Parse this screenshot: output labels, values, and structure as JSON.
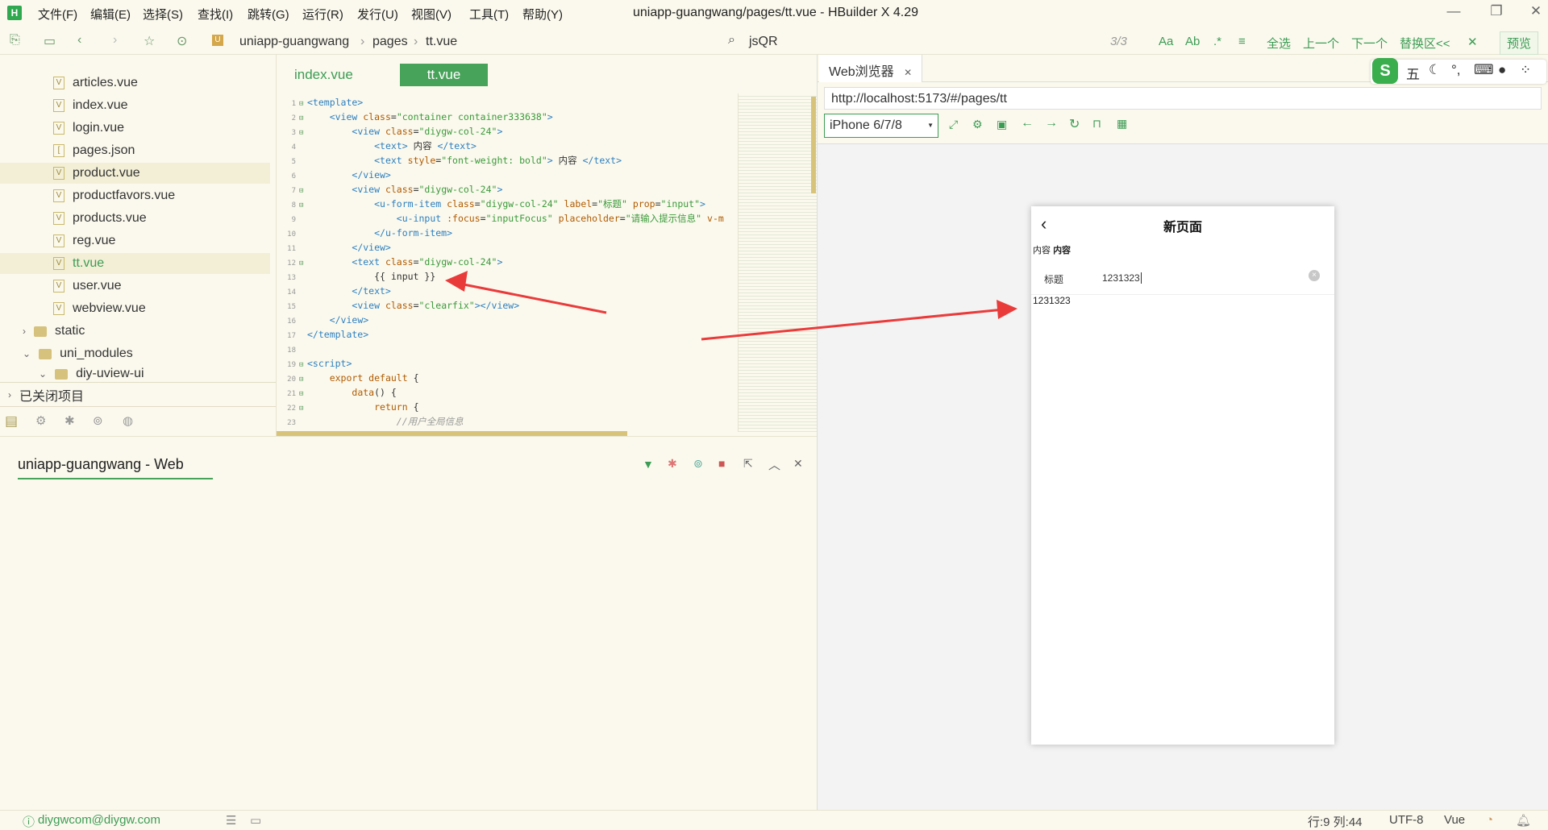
{
  "menu": [
    "文件(F)",
    "编辑(E)",
    "选择(S)",
    "查找(I)",
    "跳转(G)",
    "运行(R)",
    "发行(U)",
    "视图(V)",
    "工具(T)",
    "帮助(Y)"
  ],
  "window_title": "uniapp-guangwang/pages/tt.vue - HBuilder X 4.29",
  "breadcrumb": [
    "uniapp-guangwang",
    "pages",
    "tt.vue"
  ],
  "find": {
    "query": "jsQR",
    "count": "3/3",
    "select_all": "全选",
    "prev": "上一个",
    "next": "下一个",
    "replace": "替换区<<",
    "preview": "预览"
  },
  "files": [
    "articles.vue",
    "index.vue",
    "login.vue",
    "pages.json",
    "product.vue",
    "productfavors.vue",
    "products.vue",
    "reg.vue",
    "tt.vue",
    "user.vue",
    "webview.vue"
  ],
  "folders": {
    "static": "static",
    "uni_modules": "uni_modules",
    "diy": "diy-uview-ui",
    "closed": "已关闭项目"
  },
  "tabs": {
    "index": "index.vue",
    "tt": "tt.vue"
  },
  "code": [
    {
      "n": "1",
      "html": "<span class='tag'>&lt;template&gt;</span>"
    },
    {
      "n": "2",
      "html": "    <span class='tag'>&lt;view </span><span class='attr'>class</span>=<span class='str'>\"container container333638\"</span><span class='tag'>&gt;</span>"
    },
    {
      "n": "3",
      "html": "        <span class='tag'>&lt;view </span><span class='attr'>class</span>=<span class='str'>\"diygw-col-24\"</span><span class='tag'>&gt;</span>"
    },
    {
      "n": "4",
      "html": "            <span class='tag'>&lt;text&gt;</span> 内容 <span class='tag'>&lt;/text&gt;</span>"
    },
    {
      "n": "5",
      "html": "            <span class='tag'>&lt;text </span><span class='attr'>style</span>=<span class='str'>\"font-weight: bold\"</span><span class='tag'>&gt;</span> 内容 <span class='tag'>&lt;/text&gt;</span>"
    },
    {
      "n": "6",
      "html": "        <span class='tag'>&lt;/view&gt;</span>"
    },
    {
      "n": "7",
      "html": "        <span class='tag'>&lt;view </span><span class='attr'>class</span>=<span class='str'>\"diygw-col-24\"</span><span class='tag'>&gt;</span>"
    },
    {
      "n": "8",
      "html": "            <span class='tag'>&lt;u-form-item </span><span class='attr'>class</span>=<span class='str'>\"diygw-col-24\"</span> <span class='attr'>label</span>=<span class='str'>\"标题\"</span> <span class='attr'>prop</span>=<span class='str'>\"input\"</span><span class='tag'>&gt;</span>"
    },
    {
      "n": "9",
      "html": "                <span class='tag'>&lt;u-input </span><span class='attr'>:focus</span>=<span class='str'>\"inputFocus\"</span> <span class='attr'>placeholder</span>=<span class='str'>\"请输入提示信息\"</span> <span class='attr'>v-m</span>"
    },
    {
      "n": "10",
      "html": "            <span class='tag'>&lt;/u-form-item&gt;</span>"
    },
    {
      "n": "11",
      "html": "        <span class='tag'>&lt;/view&gt;</span>"
    },
    {
      "n": "12",
      "html": "        <span class='tag'>&lt;text </span><span class='attr'>class</span>=<span class='str'>\"diygw-col-24\"</span><span class='tag'>&gt;</span>"
    },
    {
      "n": "13",
      "html": "            {{ input }}"
    },
    {
      "n": "14",
      "html": "        <span class='tag'>&lt;/text&gt;</span>"
    },
    {
      "n": "15",
      "html": "        <span class='tag'>&lt;view </span><span class='attr'>class</span>=<span class='str'>\"clearfix\"</span><span class='tag'>&gt;&lt;/view&gt;</span>"
    },
    {
      "n": "16",
      "html": "    <span class='tag'>&lt;/view&gt;</span>"
    },
    {
      "n": "17",
      "html": "<span class='tag'>&lt;/template&gt;</span>"
    },
    {
      "n": "18",
      "html": ""
    },
    {
      "n": "19",
      "html": "<span class='tag'>&lt;script&gt;</span>"
    },
    {
      "n": "20",
      "html": "    <span class='attr'>export default</span> {"
    },
    {
      "n": "21",
      "html": "        <span class='attr'>data</span>() {"
    },
    {
      "n": "22",
      "html": "            <span class='attr'>return</span> {"
    },
    {
      "n": "23",
      "html": "                <span class='cmt'>//用户全局信息</span>"
    }
  ],
  "console_title": "uniapp-guangwang - Web",
  "browser": {
    "tab": "Web浏览器",
    "url": "http://localhost:5173/#/pages/tt",
    "device": "iPhone 6/7/8"
  },
  "ime": {
    "wubi": "五",
    "punct": "°,"
  },
  "phone": {
    "title": "新页面",
    "text1": "内容",
    "text2": "内容",
    "label": "标题",
    "input": "1231323",
    "output": "1231323"
  },
  "status": {
    "user": "diygwcom@diygw.com",
    "pos": "行:9  列:44",
    "enc": "UTF-8",
    "lang": "Vue"
  }
}
